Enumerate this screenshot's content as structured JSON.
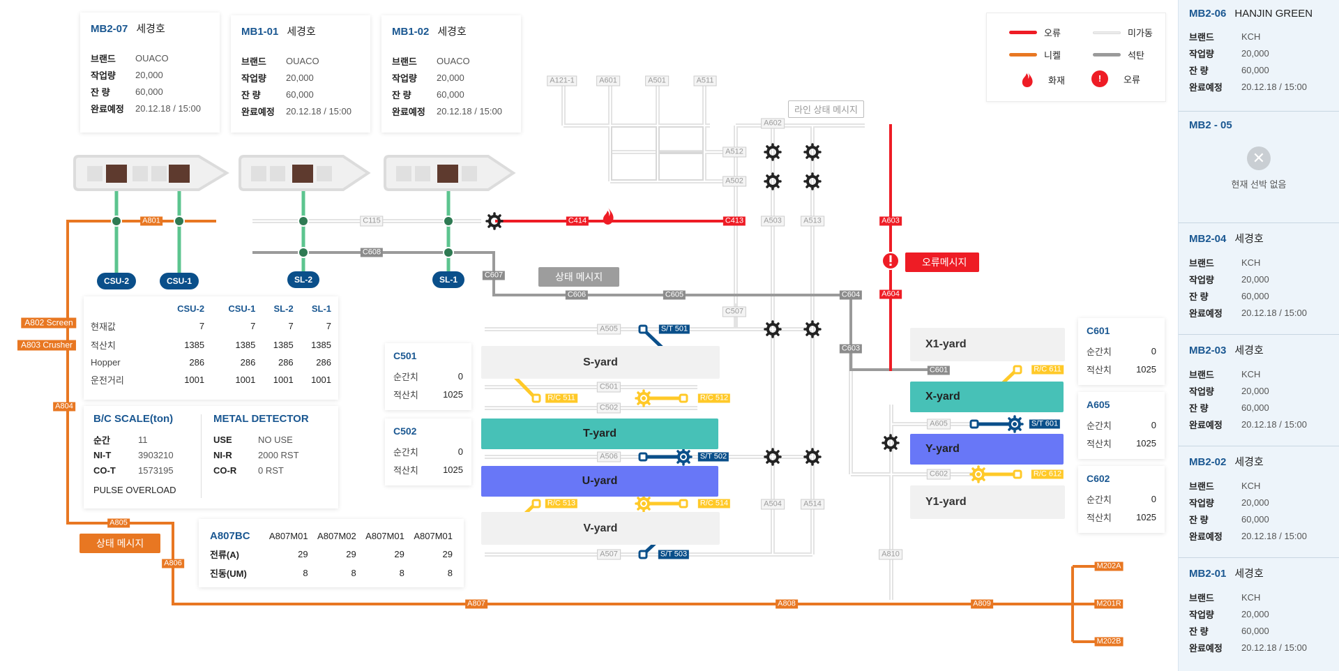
{
  "ship_cards": [
    {
      "code": "MB2-07",
      "name": "세경호",
      "rows": [
        {
          "k": "브랜드",
          "v": "OUACO"
        },
        {
          "k": "작업량",
          "v": "20,000"
        },
        {
          "k": "잔  량",
          "v": "60,000"
        },
        {
          "k": "완료예정",
          "v": "20.12.18 / 15:00"
        }
      ]
    },
    {
      "code": "MB1-01",
      "name": "세경호",
      "rows": [
        {
          "k": "브랜드",
          "v": "OUACO"
        },
        {
          "k": "작업량",
          "v": "20,000"
        },
        {
          "k": "잔  량",
          "v": "60,000"
        },
        {
          "k": "완료예정",
          "v": "20.12.18 / 15:00"
        }
      ]
    },
    {
      "code": "MB1-02",
      "name": "세경호",
      "rows": [
        {
          "k": "브랜드",
          "v": "OUACO"
        },
        {
          "k": "작업량",
          "v": "20,000"
        },
        {
          "k": "잔  량",
          "v": "60,000"
        },
        {
          "k": "완료예정",
          "v": "20.12.18 / 15:00"
        }
      ]
    }
  ],
  "legend": {
    "error_line": "오류",
    "idle_line": "미가동",
    "nickel_line": "니켈",
    "coal_line": "석탄",
    "fire": "화재",
    "error_icon": "오류",
    "colors": {
      "error": "#ee1c25",
      "idle": "#e6e6e6",
      "nickel": "#e87722",
      "coal": "#9a9a9a"
    }
  },
  "unloaders": {
    "csu2": "CSU-2",
    "csu1": "CSU-1",
    "sl2": "SL-2",
    "sl1": "SL-1"
  },
  "unloader_table": {
    "columns": [
      "CSU-2",
      "CSU-1",
      "SL-2",
      "SL-1"
    ],
    "rows": [
      {
        "k": "현재값",
        "v": [
          "7",
          "7",
          "7",
          "7"
        ]
      },
      {
        "k": "적산치",
        "v": [
          "1385",
          "1385",
          "1385",
          "1385"
        ]
      },
      {
        "k": "Hopper",
        "v": [
          "286",
          "286",
          "286",
          "286"
        ]
      },
      {
        "k": "운전거리",
        "v": [
          "1001",
          "1001",
          "1001",
          "1001"
        ]
      }
    ]
  },
  "scale": {
    "bc_title": "B/C SCALE(ton)",
    "bc_rows": [
      {
        "k": "순간",
        "v": "11"
      },
      {
        "k": "NI-T",
        "v": "3903210"
      },
      {
        "k": "CO-T",
        "v": "1573195"
      }
    ],
    "md_title": "METAL DETECTOR",
    "md_rows": [
      {
        "k": "USE",
        "v": "NO USE"
      },
      {
        "k": "NI-R",
        "v": "2000 RST"
      },
      {
        "k": "CO-R",
        "v": "0 RST"
      }
    ],
    "pulse": "PULSE OVERLOAD"
  },
  "a807bc": {
    "title": "A807BC",
    "columns": [
      "A807M01",
      "A807M02",
      "A807M01",
      "A807M01"
    ],
    "rows": [
      {
        "k": "전류(A)",
        "v": [
          "29",
          "29",
          "29",
          "29"
        ]
      },
      {
        "k": "진동(UM)",
        "v": [
          "8",
          "8",
          "8",
          "8"
        ]
      }
    ]
  },
  "side_labels": {
    "a802": "A802 Screen",
    "a803": "A803 Crusher",
    "a804": "A804",
    "a805": "A805",
    "a806": "A806",
    "a801": "A801",
    "status_msg": "상태 메시지"
  },
  "conveyor_tags": {
    "C115": "C115",
    "C608": "C608",
    "C607": "C607",
    "C606": "C606",
    "C605": "C605",
    "C604": "C604",
    "C603": "C603",
    "C601": "C601",
    "C602": "C602",
    "C507": "C507",
    "C414": "C414",
    "C413": "C413",
    "A603": "A603",
    "A604": "A604",
    "A602": "A602",
    "A512": "A512",
    "A502": "A502",
    "A503": "A503",
    "A513": "A513",
    "A121_1": "A121-1",
    "A601": "A601",
    "A501": "A501",
    "A511": "A511",
    "A505": "A505",
    "C501": "C501",
    "C502": "C502",
    "A506": "A506",
    "A507": "A507",
    "A504": "A504",
    "A514": "A514",
    "A605": "A605",
    "A810": "A810",
    "A807": "A807",
    "A808": "A808",
    "A809": "A809",
    "M202A": "M202A",
    "M201R": "M201R",
    "M202B": "M202B"
  },
  "equipment_tags": {
    "st501": "S/T 501",
    "st502": "S/T 502",
    "st503": "S/T 503",
    "st601": "S/T 601",
    "rc511": "R/C 511",
    "rc512": "R/C 512",
    "rc513": "R/C 513",
    "rc514": "R/C 514",
    "rc611": "R/C 611",
    "rc612": "R/C 612"
  },
  "messages": {
    "line_status": "라인 상태 메시지",
    "status": "상태 메시지",
    "error": "오류메시지"
  },
  "yards": {
    "s": "S-yard",
    "t": "T-yard",
    "u": "U-yard",
    "v": "V-yard",
    "x1": "X1-yard",
    "x": "X-yard",
    "y": "Y-yard",
    "y1": "Y1-yard"
  },
  "counters": [
    {
      "title": "C501",
      "rows": [
        {
          "k": "순간치",
          "v": "0"
        },
        {
          "k": "적산치",
          "v": "1025"
        }
      ]
    },
    {
      "title": "C502",
      "rows": [
        {
          "k": "순간치",
          "v": "0"
        },
        {
          "k": "적산치",
          "v": "1025"
        }
      ]
    },
    {
      "title": "C601",
      "rows": [
        {
          "k": "순간치",
          "v": "0"
        },
        {
          "k": "적산치",
          "v": "1025"
        }
      ]
    },
    {
      "title": "A605",
      "rows": [
        {
          "k": "순간치",
          "v": "0"
        },
        {
          "k": "적산치",
          "v": "1025"
        }
      ]
    },
    {
      "title": "C602",
      "rows": [
        {
          "k": "순간치",
          "v": "0"
        },
        {
          "k": "적산치",
          "v": "1025"
        }
      ]
    }
  ],
  "berths": [
    {
      "code": "MB2-06",
      "name": "HANJIN GREEN",
      "rows": [
        {
          "k": "브랜드",
          "v": "KCH"
        },
        {
          "k": "작업량",
          "v": "20,000"
        },
        {
          "k": "잔  량",
          "v": "60,000"
        },
        {
          "k": "완료예정",
          "v": "20.12.18 / 15:00"
        }
      ]
    },
    {
      "code": "MB2 - 05",
      "empty_text": "현재 선박 없음"
    },
    {
      "code": "MB2-04",
      "name": "세경호",
      "rows": [
        {
          "k": "브랜드",
          "v": "KCH"
        },
        {
          "k": "작업량",
          "v": "20,000"
        },
        {
          "k": "잔  량",
          "v": "60,000"
        },
        {
          "k": "완료예정",
          "v": "20.12.18 / 15:00"
        }
      ]
    },
    {
      "code": "MB2-03",
      "name": "세경호",
      "rows": [
        {
          "k": "브랜드",
          "v": "KCH"
        },
        {
          "k": "작업량",
          "v": "20,000"
        },
        {
          "k": "잔  량",
          "v": "60,000"
        },
        {
          "k": "완료예정",
          "v": "20.12.18 / 15:00"
        }
      ]
    },
    {
      "code": "MB2-02",
      "name": "세경호",
      "rows": [
        {
          "k": "브랜드",
          "v": "KCH"
        },
        {
          "k": "작업량",
          "v": "20,000"
        },
        {
          "k": "잔  량",
          "v": "60,000"
        },
        {
          "k": "완료예정",
          "v": "20.12.18 / 15:00"
        }
      ]
    },
    {
      "code": "MB2-01",
      "name": "세경호",
      "rows": [
        {
          "k": "브랜드",
          "v": "KCH"
        },
        {
          "k": "작업량",
          "v": "20,000"
        },
        {
          "k": "잔  량",
          "v": "60,000"
        },
        {
          "k": "완료예정",
          "v": "20.12.18 / 15:00"
        }
      ]
    }
  ]
}
